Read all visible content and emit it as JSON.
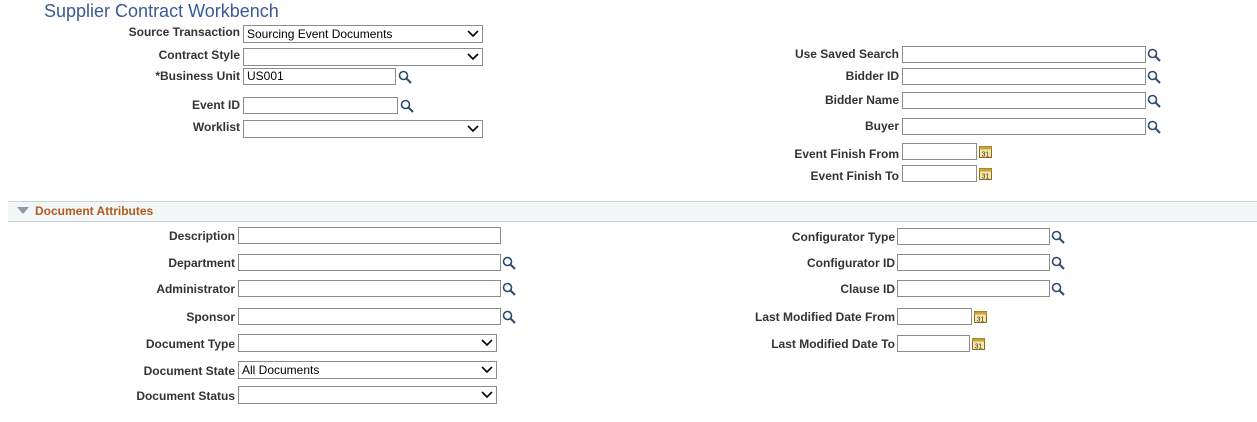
{
  "page": {
    "title": "Supplier Contract Workbench"
  },
  "search": {
    "source_transaction": {
      "label": "Source Transaction",
      "value": "Sourcing Event Documents"
    },
    "contract_style": {
      "label": "Contract Style",
      "value": ""
    },
    "business_unit": {
      "label": "*Business Unit",
      "value": "US001"
    },
    "event_id": {
      "label": "Event ID",
      "value": ""
    },
    "worklist": {
      "label": "Worklist",
      "value": ""
    },
    "use_saved_search": {
      "label": "Use Saved Search",
      "value": ""
    },
    "bidder_id": {
      "label": "Bidder ID",
      "value": ""
    },
    "bidder_name": {
      "label": "Bidder Name",
      "value": ""
    },
    "buyer": {
      "label": "Buyer",
      "value": ""
    },
    "event_finish_from": {
      "label": "Event Finish From",
      "value": ""
    },
    "event_finish_to": {
      "label": "Event Finish To",
      "value": ""
    }
  },
  "document_attributes": {
    "section_title": "Document Attributes",
    "description": {
      "label": "Description",
      "value": ""
    },
    "department": {
      "label": "Department",
      "value": ""
    },
    "administrator": {
      "label": "Administrator",
      "value": ""
    },
    "sponsor": {
      "label": "Sponsor",
      "value": ""
    },
    "document_type": {
      "label": "Document Type",
      "value": ""
    },
    "document_state": {
      "label": "Document State",
      "value": "All Documents"
    },
    "document_status": {
      "label": "Document Status",
      "value": ""
    },
    "configurator_type": {
      "label": "Configurator Type",
      "value": ""
    },
    "configurator_id": {
      "label": "Configurator ID",
      "value": ""
    },
    "clause_id": {
      "label": "Clause ID",
      "value": ""
    },
    "last_modified_from": {
      "label": "Last Modified Date From",
      "value": ""
    },
    "last_modified_to": {
      "label": "Last Modified Date To",
      "value": ""
    }
  },
  "icons": {
    "lookup": "magnifier-icon",
    "calendar": "calendar-icon",
    "collapse": "triangle-down-icon"
  },
  "colors": {
    "title": "#3b5998",
    "section_title": "#b25a1e",
    "section_bg": "#f2f6f6"
  }
}
